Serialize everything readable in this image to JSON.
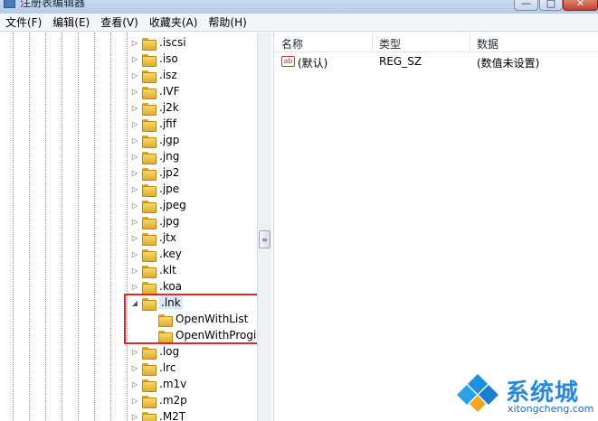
{
  "window": {
    "title": "注册表编辑器",
    "min_glyph": "—",
    "max_glyph": "□",
    "close_glyph": "✕"
  },
  "menu": [
    "文件(F)",
    "编辑(E)",
    "查看(V)",
    "收藏夹(A)",
    "帮助(H)"
  ],
  "tree": {
    "items": [
      {
        "label": ".iscsi",
        "expander": "▷"
      },
      {
        "label": ".iso",
        "expander": "▷"
      },
      {
        "label": ".isz",
        "expander": "▷"
      },
      {
        "label": ".IVF",
        "expander": "▷"
      },
      {
        "label": ".j2k",
        "expander": "▷"
      },
      {
        "label": ".jfif",
        "expander": "▷"
      },
      {
        "label": ".jgp",
        "expander": "▷"
      },
      {
        "label": ".jng",
        "expander": "▷"
      },
      {
        "label": ".jp2",
        "expander": "▷"
      },
      {
        "label": ".jpe",
        "expander": "▷"
      },
      {
        "label": ".jpeg",
        "expander": "▷"
      },
      {
        "label": ".jpg",
        "expander": "▷"
      },
      {
        "label": ".jtx",
        "expander": "▷"
      },
      {
        "label": ".key",
        "expander": "▷"
      },
      {
        "label": ".klt",
        "expander": "▷"
      },
      {
        "label": ".koa",
        "expander": "▷"
      },
      {
        "label": ".lnk",
        "expander": "◢",
        "selected": true
      },
      {
        "label": "OpenWithList",
        "expander": "",
        "child": true
      },
      {
        "label": "OpenWithProgids",
        "expander": "",
        "child": true
      },
      {
        "label": ".log",
        "expander": "▷"
      },
      {
        "label": ".lrc",
        "expander": "▷"
      },
      {
        "label": ".m1v",
        "expander": "▷"
      },
      {
        "label": ".m2p",
        "expander": "▷"
      },
      {
        "label": ".M2T",
        "expander": "▷"
      }
    ]
  },
  "list": {
    "columns": [
      "名称",
      "类型",
      "数据"
    ],
    "rows": [
      {
        "icon": "ab",
        "name": "(默认)",
        "type": "REG_SZ",
        "data": "(数值未设置)"
      }
    ]
  },
  "watermark": {
    "name": "系统城",
    "url": "xitongcheng.com"
  },
  "colors": {
    "highlight_box": "#e0262a",
    "folder": "#f2c94c",
    "watermark": "#2b87d8"
  }
}
